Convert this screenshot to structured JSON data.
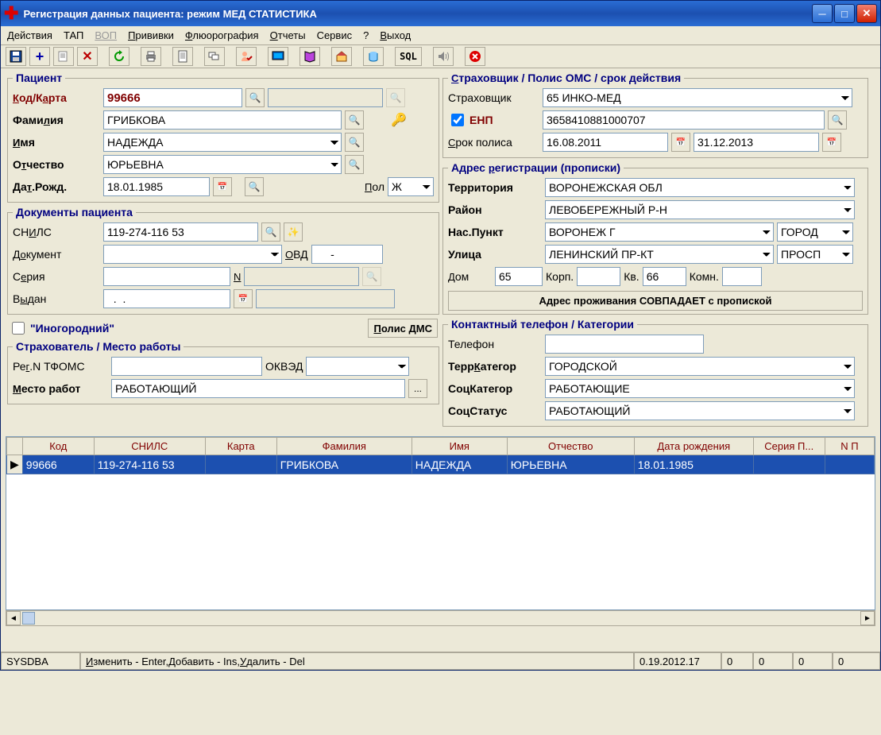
{
  "window": {
    "title": "Регистрация данных пациента: режим МЕД СТАТИСТИКА"
  },
  "menu": {
    "actions": "Действия",
    "tap": "ТАП",
    "vop": "ВОП",
    "vaccines": "Прививки",
    "fluoro": "Флюорография",
    "reports": "Отчеты",
    "service": "Сервис",
    "help": "?",
    "exit": "Выход"
  },
  "patient": {
    "legend": "Пациент",
    "code_label": "Код/Карта",
    "code": "99666",
    "surname_label": "Фамилия",
    "surname": "ГРИБКОВА",
    "name_label": "Имя",
    "name": "НАДЕЖДА",
    "patronymic_label": "Отчество",
    "patronymic": "ЮРЬЕВНА",
    "dob_label": "Дат.Рожд.",
    "dob": "18.01.1985",
    "sex_label": "Пол",
    "sex": "Ж"
  },
  "docs": {
    "legend": "Документы пациента",
    "snils_label": "СНИЛС",
    "snils": "119-274-116 53",
    "doc_label": "Документ",
    "ovd_label": "ОВД",
    "ovd_value": "     -",
    "series_label": "Серия",
    "n_label": "N",
    "issued_label": "Выдан",
    "issued_date": "  .  .    "
  },
  "nonresident": "\"Иногородний\"",
  "polis_dms_btn": "Полис ДМС",
  "employer": {
    "legend": "Страхователь /  Место работы",
    "regn_label": "Рег.N ТФОМС",
    "okved_label": "ОКВЭД",
    "place_label": "Место работ",
    "place": "РАБОТАЮЩИЙ"
  },
  "insurer": {
    "legend": "Страховщик / Полис ОМС / срок действия",
    "insurer_label": "Страховщик",
    "insurer": "65 ИНКО-МЕД",
    "enp_label": "ЕНП",
    "enp": "3658410881000707",
    "term_label": "Срок полиса",
    "term_from": "16.08.2011",
    "term_to": "31.12.2013"
  },
  "address": {
    "legend": "Адрес регистрации (прописки)",
    "territory_label": "Территория",
    "territory": "ВОРОНЕЖСКАЯ ОБЛ",
    "district_label": "Район",
    "district": "ЛЕВОБЕРЕЖНЫЙ Р-Н",
    "settlement_label": "Нас.Пункт",
    "settlement": "ВОРОНЕЖ Г",
    "settlement_type": "ГОРОД",
    "street_label": "Улица",
    "street": "ЛЕНИНСКИЙ ПР-КТ",
    "street_type": "ПРОСП",
    "house_label": "Дом",
    "house": "65",
    "korp_label": "Корп.",
    "flat_label": "Кв.",
    "flat": "66",
    "room_label": "Комн.",
    "match_btn": "Адрес проживания СОВПАДАЕТ с пропиской"
  },
  "contact": {
    "legend": "Контактный телефон  / Категории",
    "phone_label": "Телефон",
    "terrcat_label": "ТеррКатегор",
    "terrcat": "ГОРОДСКОЙ",
    "soccat_label": "СоцКатегор",
    "soccat": "РАБОТАЮЩИЕ",
    "socstat_label": "СоцСтатус",
    "socstat": "РАБОТАЮЩИЙ"
  },
  "grid": {
    "headers": {
      "code": "Код",
      "snils": "СНИЛС",
      "card": "Карта",
      "surname": "Фамилия",
      "name": "Имя",
      "patronymic": "Отчество",
      "dob": "Дата рождения",
      "series": "Серия П...",
      "n": "N П"
    },
    "row": {
      "code": "99666",
      "snils": "119-274-116 53",
      "card": "",
      "surname": "ГРИБКОВА",
      "name": "НАДЕЖДА",
      "patronymic": "ЮРЬЕВНА",
      "dob": "18.01.1985"
    }
  },
  "status": {
    "user": "SYSDBA",
    "hint": "Изменить - Enter, Добавить - Ins, Удалить - Del",
    "version": "0.19.2012.17",
    "c1": "0",
    "c2": "0",
    "c3": "0",
    "c4": "0"
  }
}
